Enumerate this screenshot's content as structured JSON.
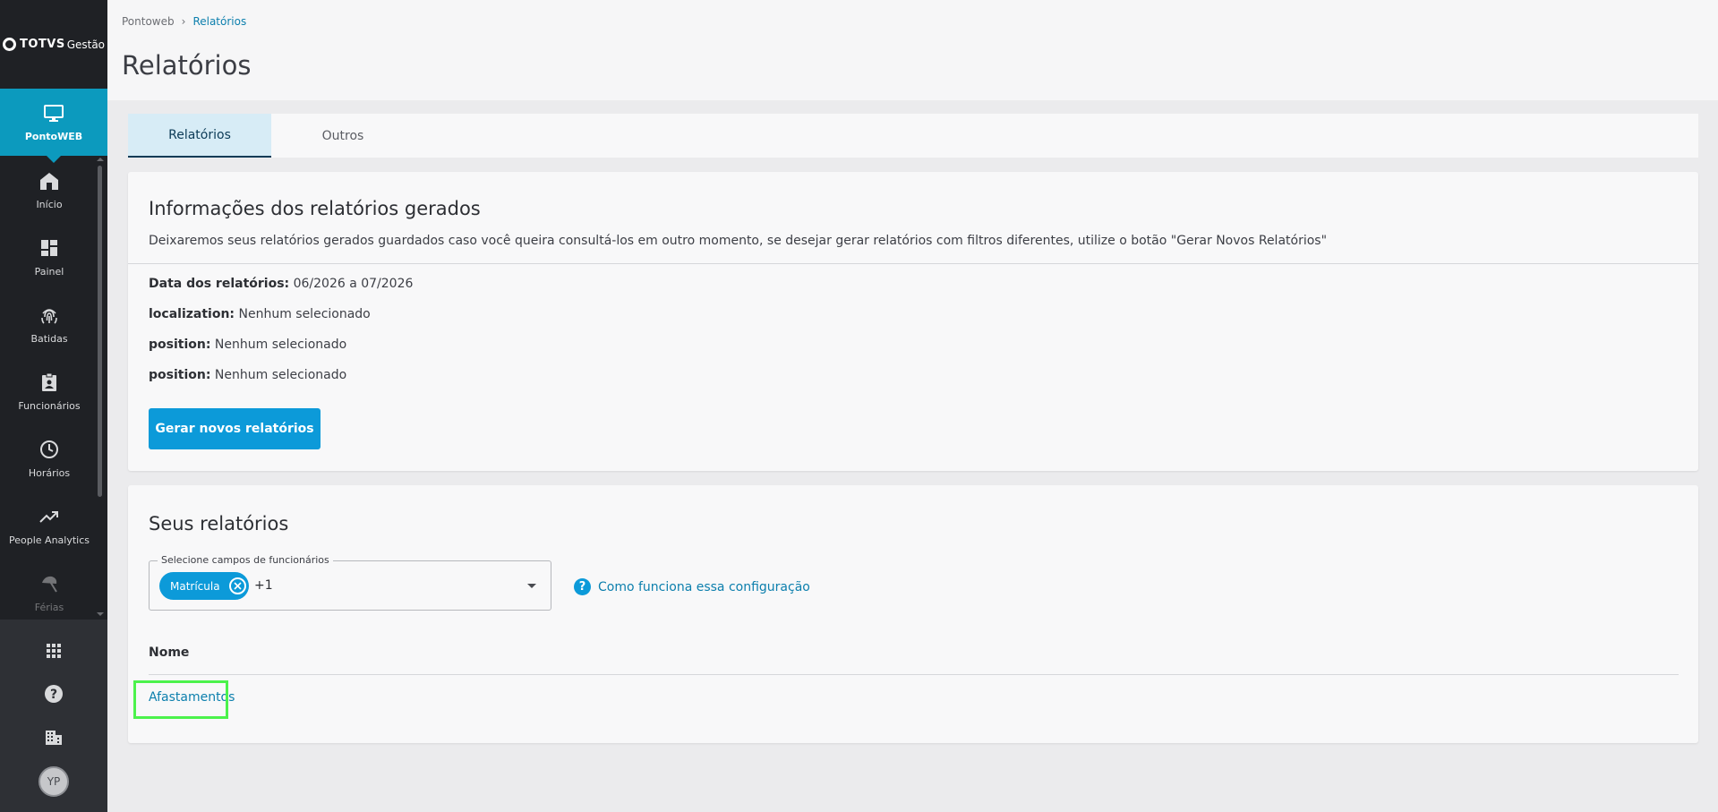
{
  "sidebar": {
    "logo": {
      "brand": "TOTVS",
      "product": "Gestão"
    },
    "active_item": {
      "label": "PontoWEB",
      "icon": "monitor-icon"
    },
    "items": [
      {
        "label": "Início",
        "icon": "home-icon"
      },
      {
        "label": "Painel",
        "icon": "dashboard-icon"
      },
      {
        "label": "Batidas",
        "icon": "fingerprint-icon"
      },
      {
        "label": "Funcionários",
        "icon": "badge-icon"
      },
      {
        "label": "Horários",
        "icon": "clock-icon"
      },
      {
        "label": "People Analytics",
        "icon": "trending-up-icon"
      },
      {
        "label": "Férias",
        "icon": "beach-umbrella-icon"
      }
    ],
    "bottom": {
      "apps_icon": "apps-grid-icon",
      "help_icon": "help-icon",
      "company_icon": "building-icon",
      "avatar_initials": "YP"
    }
  },
  "header": {
    "breadcrumb": {
      "root": "Pontoweb",
      "current": "Relatórios"
    },
    "title": "Relatórios"
  },
  "tabs": [
    {
      "label": "Relatórios",
      "active": true
    },
    {
      "label": "Outros",
      "active": false
    }
  ],
  "info_card": {
    "title": "Informações dos relatórios gerados",
    "description": "Deixaremos seus relatórios gerados guardados caso você queira consultá-los em outro momento, se desejar gerar relatórios com filtros diferentes, utilize o botão \"Gerar Novos Relatórios\"",
    "fields": [
      {
        "label": "Data dos relatórios:",
        "value": "06/2026 a 07/2026"
      },
      {
        "label": "localization:",
        "value": "Nenhum selecionado"
      },
      {
        "label": "position:",
        "value": "Nenhum selecionado"
      },
      {
        "label": "position:",
        "value": "Nenhum selecionado"
      }
    ],
    "button_label": "Gerar novos relatórios"
  },
  "reports_card": {
    "title": "Seus relatórios",
    "select": {
      "label": "Selecione campos de funcionários",
      "chip": "Matrícula",
      "more": "+1"
    },
    "help_link": "Como funciona essa configuração",
    "column_header": "Nome",
    "rows": [
      {
        "name": "Afastamentos"
      }
    ]
  },
  "colors": {
    "sidebar_bg": "#1f2125",
    "active_nav": "#0c9abe",
    "primary": "#0c9ad9",
    "link": "#0c7fad",
    "focus_highlight": "#4cf24c"
  }
}
